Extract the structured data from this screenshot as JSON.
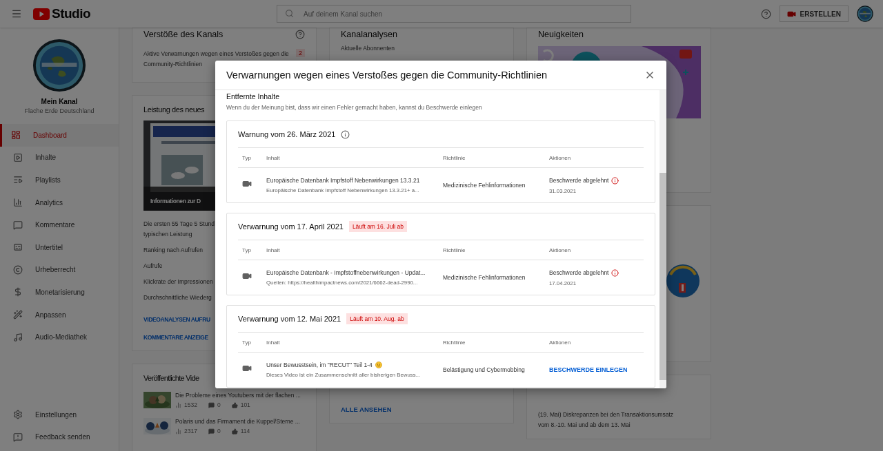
{
  "topbar": {
    "logo_text": "Studio",
    "search": {
      "placeholder": "Auf deinem Kanal suchen"
    },
    "create_button": "ERSTELLEN"
  },
  "sidebar": {
    "channel_name": "Mein Kanal",
    "channel_subtitle": "Flache Erde Deutschland",
    "items": [
      {
        "label": "Dashboard",
        "selected": true
      },
      {
        "label": "Inhalte",
        "selected": false
      },
      {
        "label": "Playlists",
        "selected": false
      },
      {
        "label": "Analytics",
        "selected": false
      },
      {
        "label": "Kommentare",
        "selected": false
      },
      {
        "label": "Untertitel",
        "selected": false
      },
      {
        "label": "Urheberrecht",
        "selected": false
      },
      {
        "label": "Monetarisierung",
        "selected": false
      },
      {
        "label": "Anpassen",
        "selected": false
      },
      {
        "label": "Audio-Mediathek",
        "selected": false
      }
    ],
    "footer_items": [
      "Einstellungen",
      "Feedback senden"
    ]
  },
  "violations_card": {
    "title": "Verstöße des Kanals",
    "text": "Aktive Verwarnungen wegen eines Verstoßes gegen die Community-Richtlinien",
    "count": "2"
  },
  "performance_card": {
    "title": "Leistung des neues",
    "thumbnail_caption": "Informationen zur D",
    "summary_lines": [
      "Die ersten 55 Tage 5 Stund",
      "typischen Leistung"
    ],
    "metrics": [
      "Ranking nach Aufrufen",
      "Aufrufe",
      "Klickrate der Impressionen",
      "Durchschnittliche Wiederg"
    ],
    "links": [
      "VIDEOANALYSEN AUFRU",
      "KOMMENTARE ANZEIGE"
    ]
  },
  "published_card": {
    "title": "Veröffentlichte Vide",
    "videos": [
      {
        "title": "Die Probleme eines Youtubers mit der flachen ...",
        "views": "1532",
        "comments": "0",
        "likes": "101"
      },
      {
        "title": "Polaris und das Firmament die Kuppel/Sterne ...",
        "views": "2317",
        "comments": "0",
        "likes": "114"
      }
    ]
  },
  "analytics_card": {
    "title": "Kanalanalysen",
    "subscribers_label": "Aktuelle Abonnenten",
    "link": "ALLE ANSEHEN"
  },
  "news_card": {
    "title": "Neuigkeiten"
  },
  "notice_card": {
    "lines": [
      "(19. Mai) Diskrepanzen bei den Transaktionsumsatz",
      "vom 8.-10. Mai und ab dem 13. Mai"
    ]
  },
  "dialog": {
    "title": "Verwarnungen wegen eines Verstoßes gegen die Community-Richtlinien",
    "section_title": "Entfernte Inhalte",
    "section_text": "Wenn du der Meinung bist, dass wir einen Fehler gemacht haben, kannst du Beschwerde einlegen",
    "strikes": [
      {
        "title": "Warnung vom 26. März 2021",
        "info_icon": true,
        "title_smiley": false,
        "columns": [
          "Typ",
          "Inhalt",
          "Richtlinie",
          "Aktionen"
        ],
        "video_title": "Europäische Datenbank Impfstoff Nebenwirkungen 13.3.21",
        "video_description": "Europäische Datenbank Impfstoff Nebenwirkungen 13.3.21+ a...",
        "policy": "Medizinische Fehlinformationen",
        "action": {
          "kind": "rejected",
          "status": "Beschwerde abgelehnt",
          "date": "31.03.2021"
        }
      },
      {
        "title": "Verwarnung vom 17. April 2021",
        "info_icon": false,
        "title_smiley": false,
        "columns": [
          "Typ",
          "Inhalt",
          "Richtlinie",
          "Aktionen"
        ],
        "expiry": "Läuft am 16. Juli ab",
        "video_title": "Europäische Datenbank - Impfstoffnebenwirkungen - Updat...",
        "video_description": "Quellen: https://healthimpactnews.com/2021/6662-dead-2990...",
        "policy": "Medizinische Fehlinformationen",
        "action": {
          "kind": "rejected",
          "status": "Beschwerde abgelehnt",
          "date": "17.04.2021"
        }
      },
      {
        "title": "Verwarnung vom 12. Mai 2021",
        "info_icon": false,
        "columns": [
          "Typ",
          "Inhalt",
          "Richtlinie",
          "Aktionen"
        ],
        "expiry": "Läuft am 10. Aug. ab",
        "video_title": "Unser Bewusstsein, im \"RECUT\" Teil 1-4",
        "title_smiley": true,
        "video_description": "Dieses Video ist ein Zusammenschnitt aller bisherigen Bewuss...",
        "policy": "Belästigung und Cybermobbing",
        "action": {
          "kind": "appeal",
          "label": "BESCHWERDE EINLEGEN"
        }
      }
    ]
  }
}
